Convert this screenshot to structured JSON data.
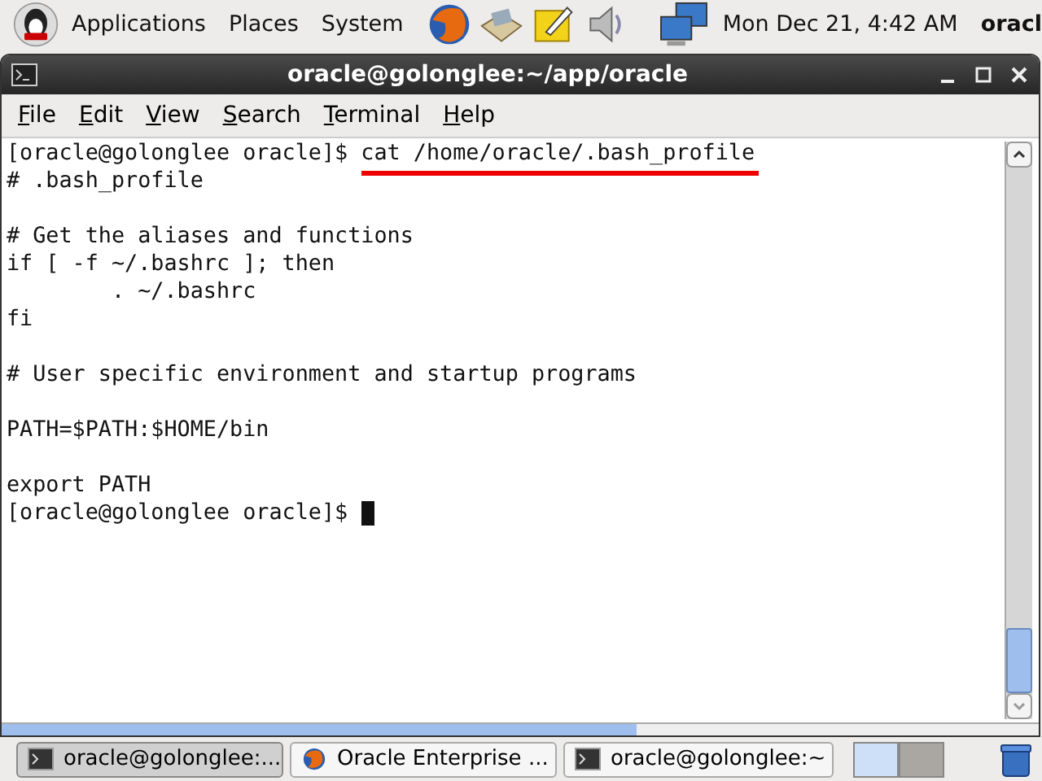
{
  "top_panel": {
    "menus": [
      "Applications",
      "Places",
      "System"
    ],
    "clock": "Mon Dec 21,  4:42 AM",
    "user": "oracl"
  },
  "window": {
    "title": "oracle@golonglee:~/app/oracle"
  },
  "menubar": [
    "File",
    "Edit",
    "View",
    "Search",
    "Terminal",
    "Help"
  ],
  "terminal": {
    "blocks": [
      {
        "lines": [
          "[oracle@golonglee oracle]$ cat /home/oracle/.bash_profile",
          "# .bash_profile"
        ]
      },
      {
        "lines": [
          "# Get the aliases and functions",
          "if [ -f ~/.bashrc ]; then",
          "        . ~/.bashrc",
          "fi"
        ]
      },
      {
        "lines": [
          "# User specific environment and startup programs"
        ]
      },
      {
        "lines": [
          "PATH=$PATH:$HOME/bin"
        ]
      },
      {
        "lines": [
          "export PATH",
          "[oracle@golonglee oracle]$ "
        ]
      }
    ]
  },
  "taskbar": {
    "items": [
      {
        "kind": "terminal",
        "label": "oracle@golonglee:...",
        "selected": true
      },
      {
        "kind": "browser",
        "label": "Oracle Enterprise ...",
        "selected": false
      },
      {
        "kind": "terminal",
        "label": "oracle@golonglee:~",
        "selected": false
      }
    ],
    "workspaces": [
      {
        "selected": true
      },
      {
        "selected": false
      }
    ]
  }
}
